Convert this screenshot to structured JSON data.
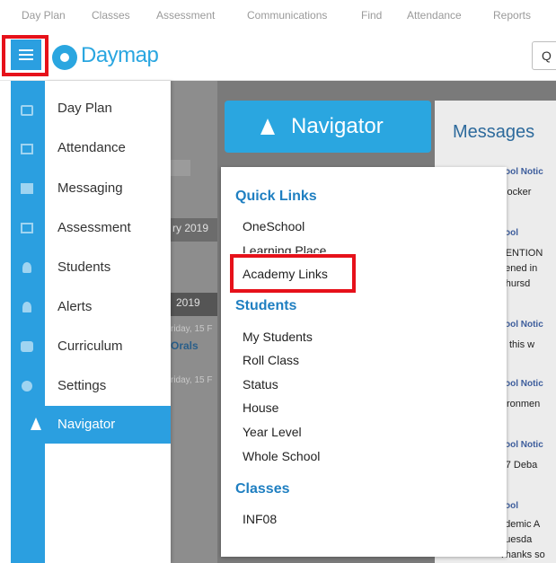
{
  "topnav": {
    "items": [
      "Day Plan",
      "Classes",
      "Assessment",
      "Communications",
      "Find",
      "Attendance",
      "Reports"
    ]
  },
  "header": {
    "logo_text": "Daymap",
    "search_glyph": "Q"
  },
  "sidebar": {
    "items": [
      {
        "label": "Day Plan",
        "icon": "calendar-icon"
      },
      {
        "label": "Attendance",
        "icon": "checkbox-icon"
      },
      {
        "label": "Messaging",
        "icon": "message-icon"
      },
      {
        "label": "Assessment",
        "icon": "assessment-icon"
      },
      {
        "label": "Students",
        "icon": "student-icon"
      },
      {
        "label": "Alerts",
        "icon": "bell-icon"
      },
      {
        "label": "Curriculum",
        "icon": "graduation-cap-icon"
      },
      {
        "label": "Settings",
        "icon": "gear-icon"
      },
      {
        "label": "Navigator",
        "icon": "navigator-arrow-icon"
      }
    ]
  },
  "background": {
    "date1": "ry 2019",
    "date2": "2019",
    "fri1": "riday, 15 F",
    "orals": "Orals",
    "fri2": "riday, 15 F"
  },
  "navigator": {
    "label": "Navigator"
  },
  "messages": {
    "title": "Messages",
    "items": [
      {
        "notice": "ool Notic",
        "text": "t locker"
      },
      {
        "notice": "ool",
        "text": "TENTION"
      },
      {
        "notice": "",
        "text": "eened in"
      },
      {
        "notice": "",
        "text": "Thursd"
      },
      {
        "notice": "ool Notic",
        "text": "N this w"
      },
      {
        "notice": "ool Notic",
        "text": "vironmen"
      },
      {
        "notice": "ool Notic",
        "text": "r 7 Deba"
      },
      {
        "notice": "ool",
        "text": "ademic A"
      },
      {
        "notice": "",
        "text": "Tuesda"
      },
      {
        "notice": "",
        "text": "Thanks so"
      }
    ]
  },
  "popup": {
    "quick_links": {
      "title": "Quick Links",
      "links": [
        "OneSchool",
        "Learning Place",
        "Academy Links"
      ]
    },
    "students": {
      "title": "Students",
      "links": [
        "My Students",
        "Roll Class",
        "Status",
        "House",
        "Year Level",
        "Whole School"
      ]
    },
    "classes": {
      "title": "Classes",
      "links": [
        "INF08"
      ]
    }
  }
}
